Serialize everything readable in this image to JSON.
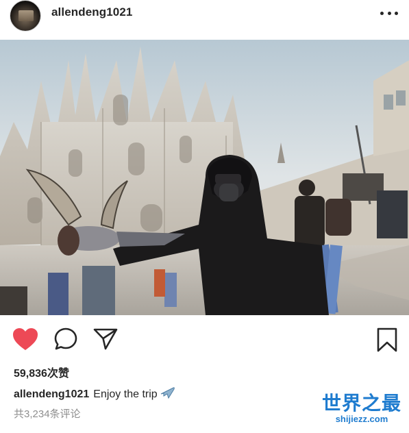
{
  "post": {
    "username": "allendeng1021",
    "avatar_icon": "avatar-photo",
    "more_icon": "more-dots-icon",
    "photo_description_icon": "post-photo"
  },
  "actions": {
    "like_icon": "heart-icon",
    "like_color": "#ed4956",
    "comment_icon": "comment-bubble-icon",
    "share_icon": "paper-plane-icon",
    "save_icon": "bookmark-icon"
  },
  "engagement": {
    "likes_text": "59,836次赞",
    "caption_user": "allendeng1021",
    "caption_text": "Enjoy the trip",
    "caption_emoji_icon": "airplane-emoji-icon",
    "comments_text": "共3,234条评论"
  },
  "watermark": {
    "cn": "世界之最",
    "en": "shijiezz.com",
    "color": "#1f7ccf"
  }
}
